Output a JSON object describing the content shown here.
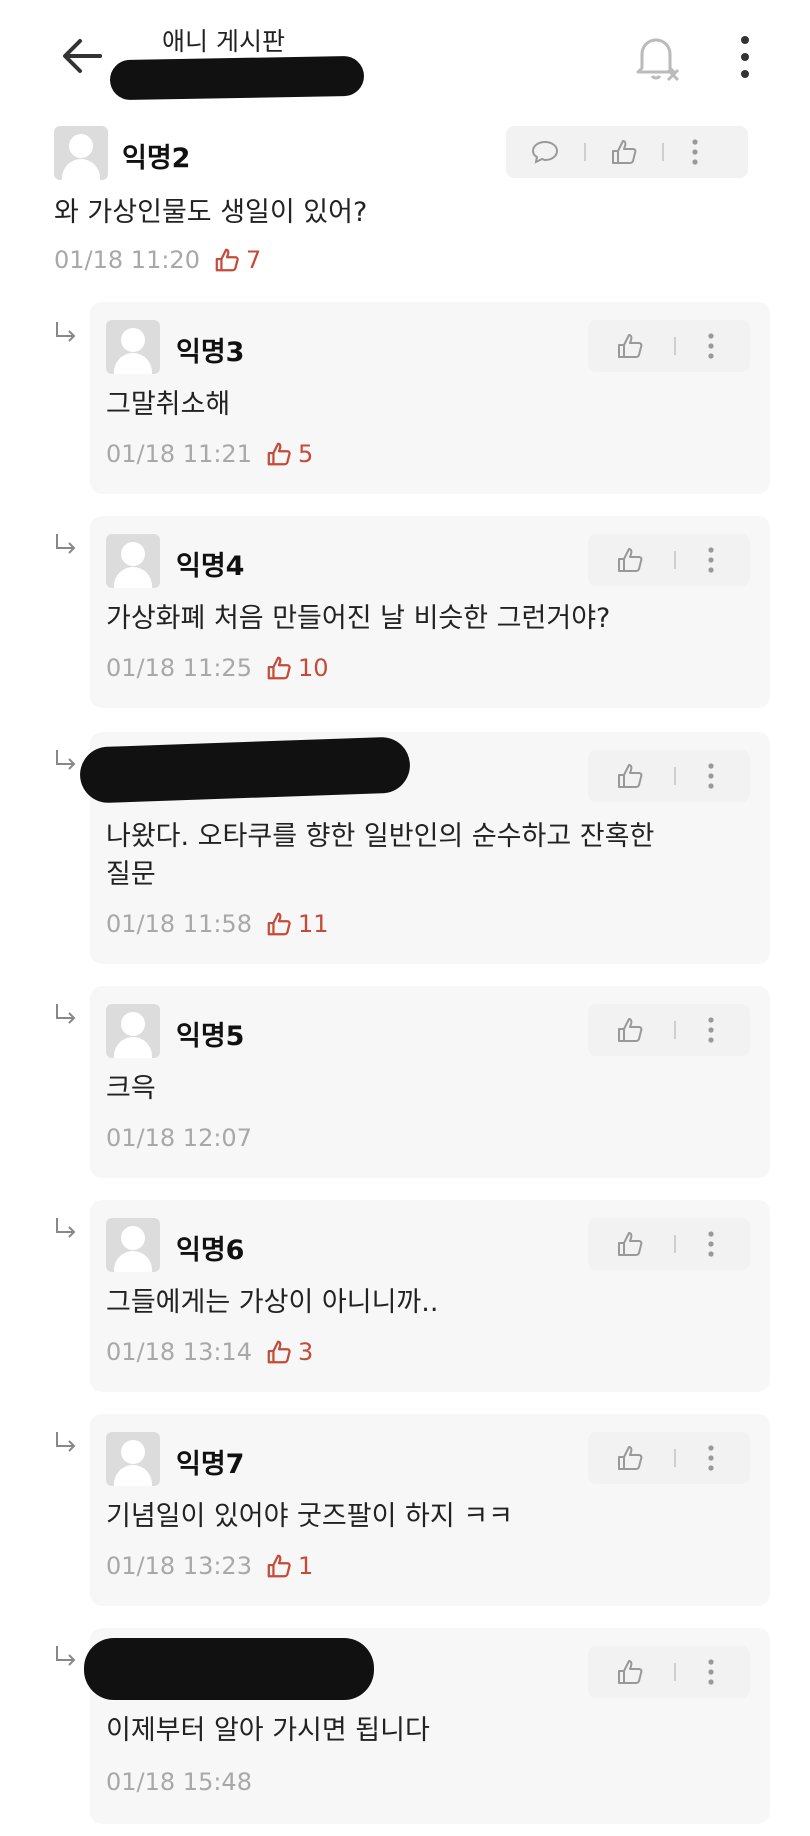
{
  "header": {
    "board_title": "애니 게시판",
    "back_icon": "arrow-left-icon",
    "bell_icon": "bell-off-icon",
    "more_icon": "more-vertical-icon"
  },
  "main_comment": {
    "author": "익명2",
    "text": "와 가상인물도 생일이 있어?",
    "timestamp": "01/18 11:20",
    "likes": "7"
  },
  "replies": [
    {
      "author": "익명3",
      "text": "그말취소해",
      "timestamp": "01/18 11:21",
      "likes": "5"
    },
    {
      "author": "익명4",
      "text": "가상화폐 처음 만들어진 날 비슷한 그런거야?",
      "timestamp": "01/18 11:25",
      "likes": "10"
    },
    {
      "author": "",
      "text_line1": "나왔다. 오타쿠를 향한 일반인의 순수하고 잔혹한",
      "text_line2": "질문",
      "timestamp": "01/18 11:58",
      "likes": "11"
    },
    {
      "author": "익명5",
      "text": "크윽",
      "timestamp": "01/18 12:07",
      "likes": ""
    },
    {
      "author": "익명6",
      "text": "그들에게는 가상이 아니니까..",
      "timestamp": "01/18 13:14",
      "likes": "3"
    },
    {
      "author": "익명7",
      "text": "기념일이 있어야 굿즈팔이 하지 ㅋㅋ",
      "timestamp": "01/18 13:23",
      "likes": "1"
    },
    {
      "author": "",
      "text": "이제부터 알아 가시면 됩니다",
      "timestamp": "01/18 15:48",
      "likes": ""
    }
  ],
  "colors": {
    "like": "#c64a3a",
    "meta": "#a8a8a8",
    "reply_bg": "#f7f7f7",
    "action_bg": "#f2f2f2"
  }
}
